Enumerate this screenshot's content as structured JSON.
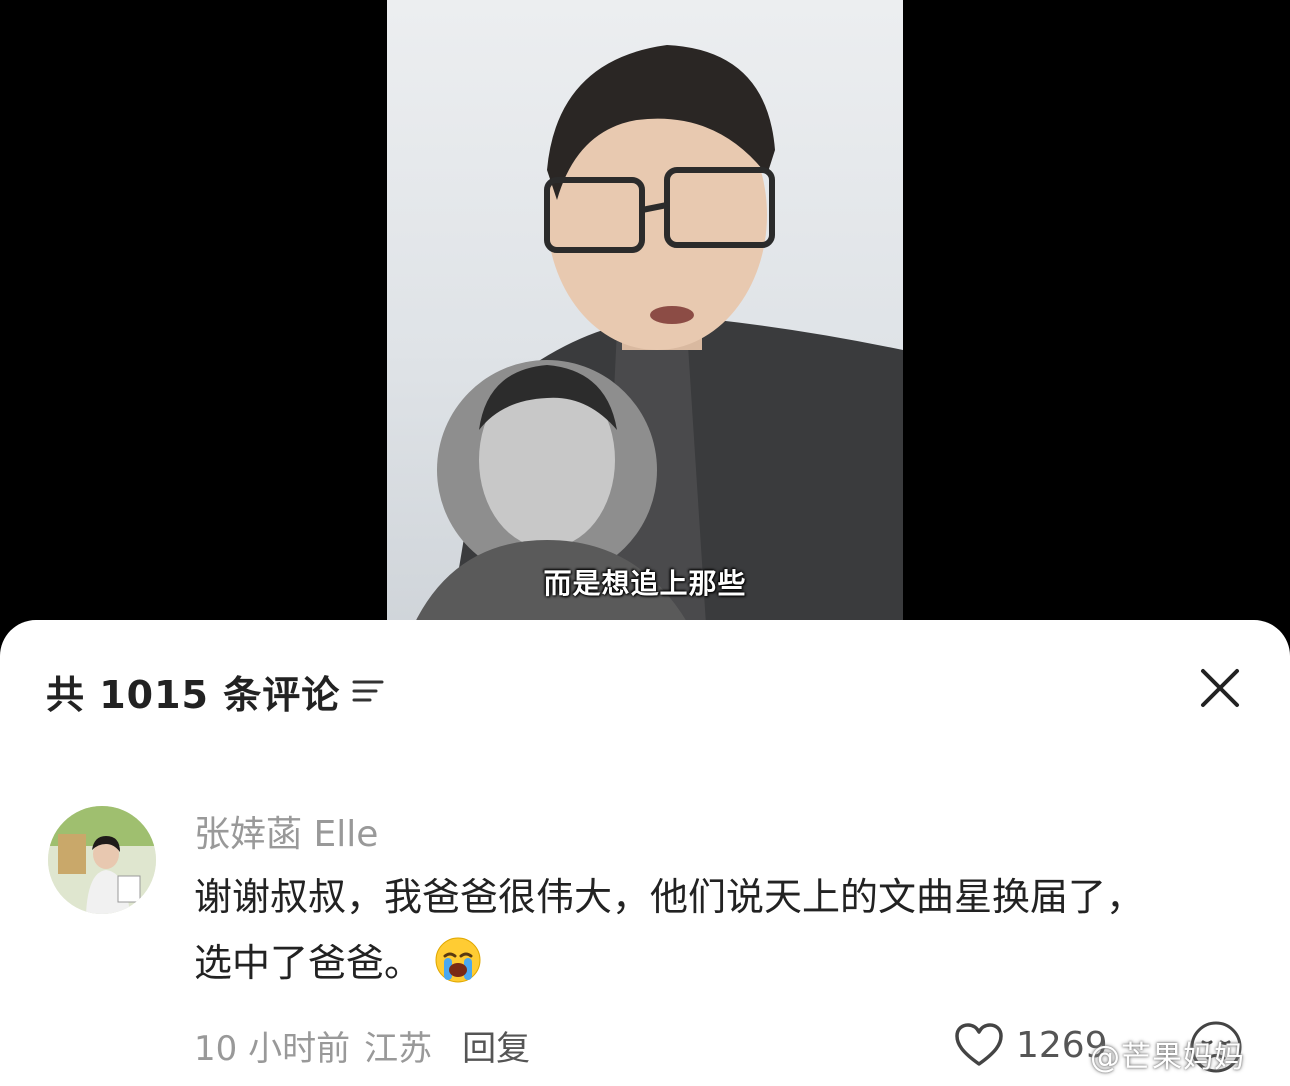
{
  "video": {
    "subtitle": "而是想追上那些"
  },
  "comments_sheet": {
    "title": "共 1015 条评论",
    "filter_icon": "filter-icon",
    "close_icon": "close-icon"
  },
  "comment": {
    "username": "张婞菡 Elle",
    "text_line1": "谢谢叔叔，我爸爸很伟大，他们说天上的文曲星换届了，",
    "text_line2": "选中了爸爸。",
    "emoji": "loudly-crying-face",
    "time": "10 小时前",
    "location": "江苏",
    "reply_label": "回复",
    "like_count": "1269",
    "like_icon": "heart-outline-icon",
    "reaction_icon": "sad-face-icon"
  },
  "watermark": "@芒果妈妈",
  "colors": {
    "sheet_bg": "#ffffff",
    "text_primary": "#222222",
    "text_secondary": "#999999"
  }
}
